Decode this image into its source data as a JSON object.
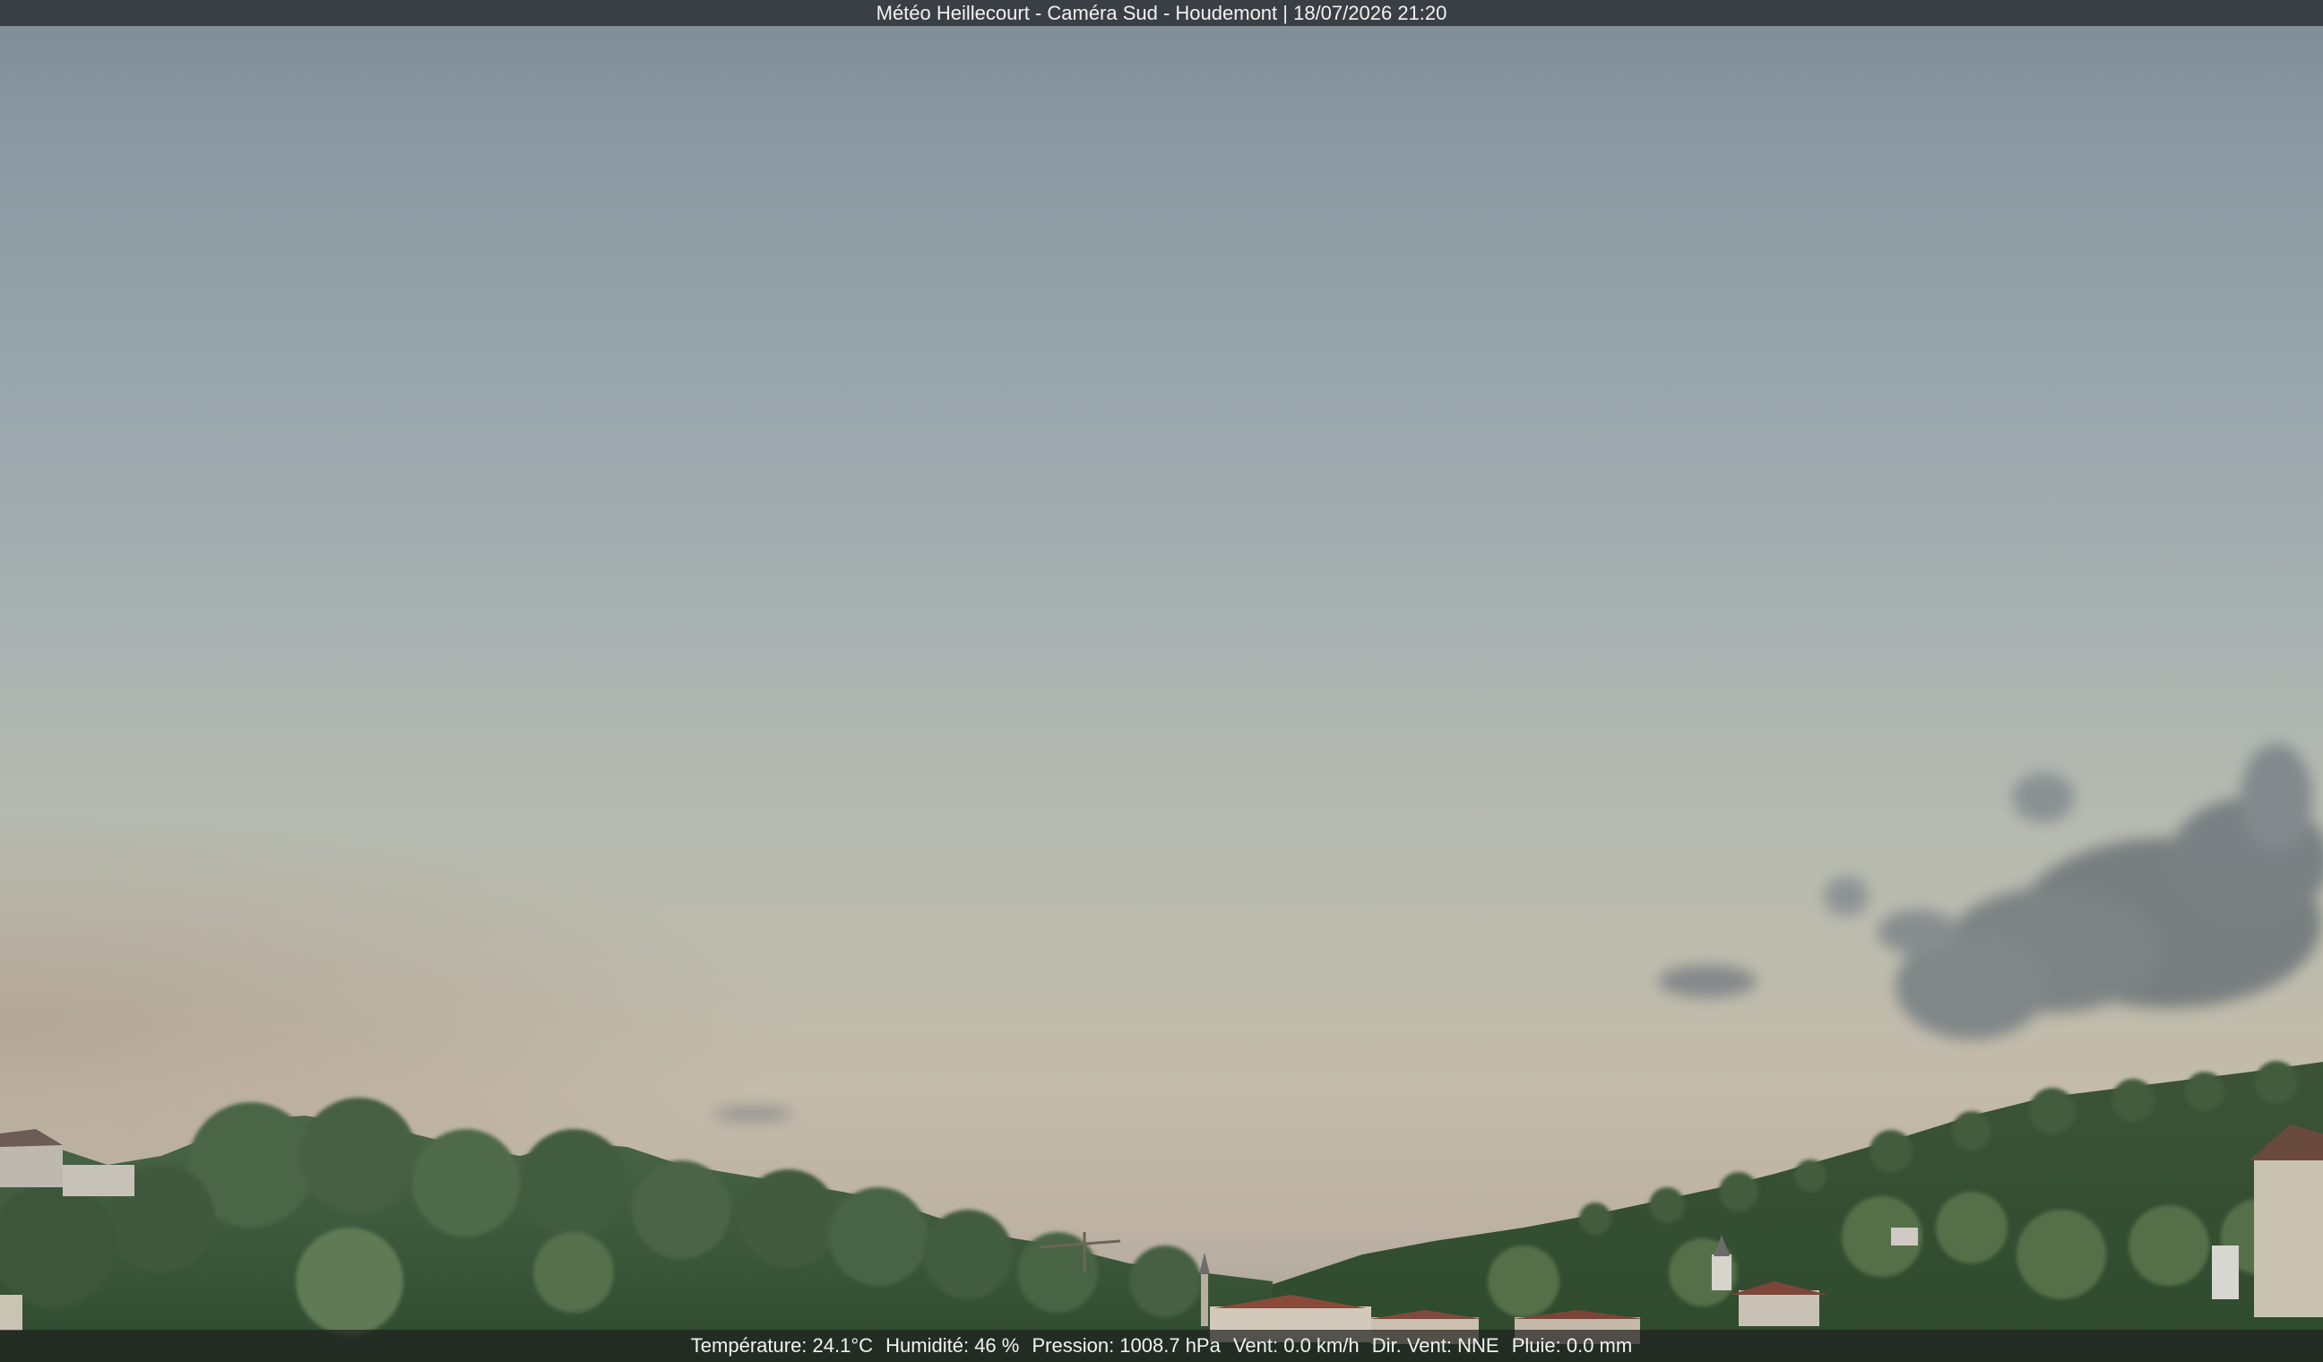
{
  "overlay": {
    "title": "Météo Heillecourt - Caméra Sud - Houdemont | 18/07/2026 21:20"
  },
  "weather": {
    "temperature": "Température: 24.1°C",
    "humidity": "Humidité: 46 %",
    "pressure": "Pression: 1008.7 hPa",
    "wind": "Vent: 0.0 km/h",
    "wind_direction": "Dir. Vent: NNE",
    "rain": "Pluie: 0.0 mm"
  },
  "colors": {
    "sky_top": "#7f8b95",
    "sky_horizon": "#c4bbaa",
    "vegetation": "#3d5a36",
    "roofs": "#8a4a3a"
  }
}
